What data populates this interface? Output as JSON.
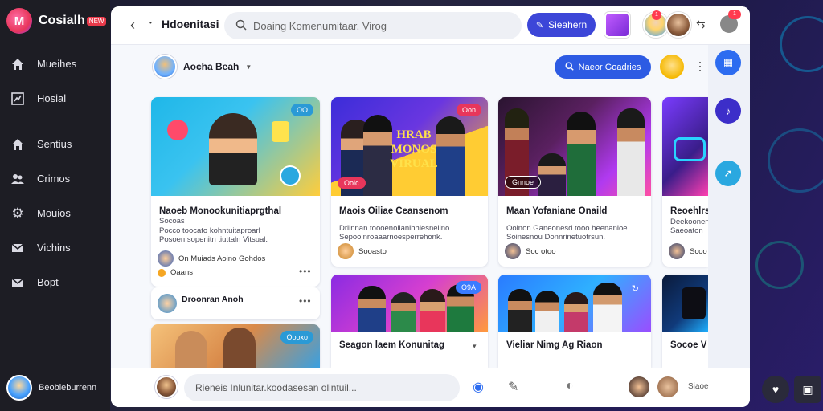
{
  "app": {
    "name": "Cosialh",
    "badge": "NEW",
    "logo_letter": "M"
  },
  "sidebar": {
    "items": [
      {
        "label": "Mueihes",
        "icon": "home-icon"
      },
      {
        "label": "Hosial",
        "icon": "chart-icon"
      },
      {
        "label": "Sentius",
        "icon": "home-icon"
      },
      {
        "label": "Crimos",
        "icon": "group-icon"
      },
      {
        "label": "Mouios",
        "icon": "gear-icon"
      },
      {
        "label": "Vichins",
        "icon": "mail-icon"
      },
      {
        "label": "Bopt",
        "icon": "mail-icon"
      }
    ],
    "profile_name": "Beobieburrenn"
  },
  "topbar": {
    "page_title": "Hdoenitasi",
    "search_placeholder": "Doaing Komenumitaar. Virog",
    "primary_button": "Sieahern",
    "notif_badge_1": "1",
    "notif_badge_2": "1"
  },
  "channel": {
    "name": "Aocha Beah",
    "action_button": "Naeor Goadries"
  },
  "cards": [
    {
      "title": "Naoeb Monookunitiaprgthal",
      "subtitle": "Socoas",
      "desc": "Pocco toocato kohntuitaproarl\nPosoen sopenitn tiuttaln Vitsual.",
      "meta_author": "On Muiads Aoino Gohdos",
      "meta_stat": "Oaans",
      "tag": "OO",
      "second_title": "Droonran Anoh"
    },
    {
      "title": "Maois Oiliae Ceansenom",
      "desc": "Driinnan toooenoiianihhlesnelino\nSepooinroaaarnoesperrehonk.",
      "meta_stat": "Sooasto",
      "tag": "Oon",
      "thumb_text": "HRAB MONOS VIRUAL",
      "thumb_btn": "Ooic"
    },
    {
      "title": "Maan Yofaniane Onaild",
      "desc": "Ooinon Ganeonesd tooo heenanioe\nSoinesnou Donnrinetuotrsun.",
      "meta_stat": "Soc otoo",
      "thumb_btn": "Gnnoe"
    },
    {
      "title": "Reoehlrs",
      "desc": "Deekoonen\nSaeoaton",
      "meta_stat": "Scoo"
    },
    {
      "title": "Seagon laem Konunitag",
      "tag": "O9A"
    },
    {
      "title": "Vieliar Nimg Ag Riaon"
    },
    {
      "title": "Socoe V"
    },
    {
      "tag": "Oooxo"
    }
  ],
  "composer": {
    "placeholder": "Rieneis Inlunitar.koodasesan olintuil...",
    "label": "Siaoe"
  },
  "colors": {
    "accent": "#3c46d8",
    "secondary": "#2d5be3",
    "sidebar": "#1d1d24",
    "badge": "#ff3b4f"
  }
}
